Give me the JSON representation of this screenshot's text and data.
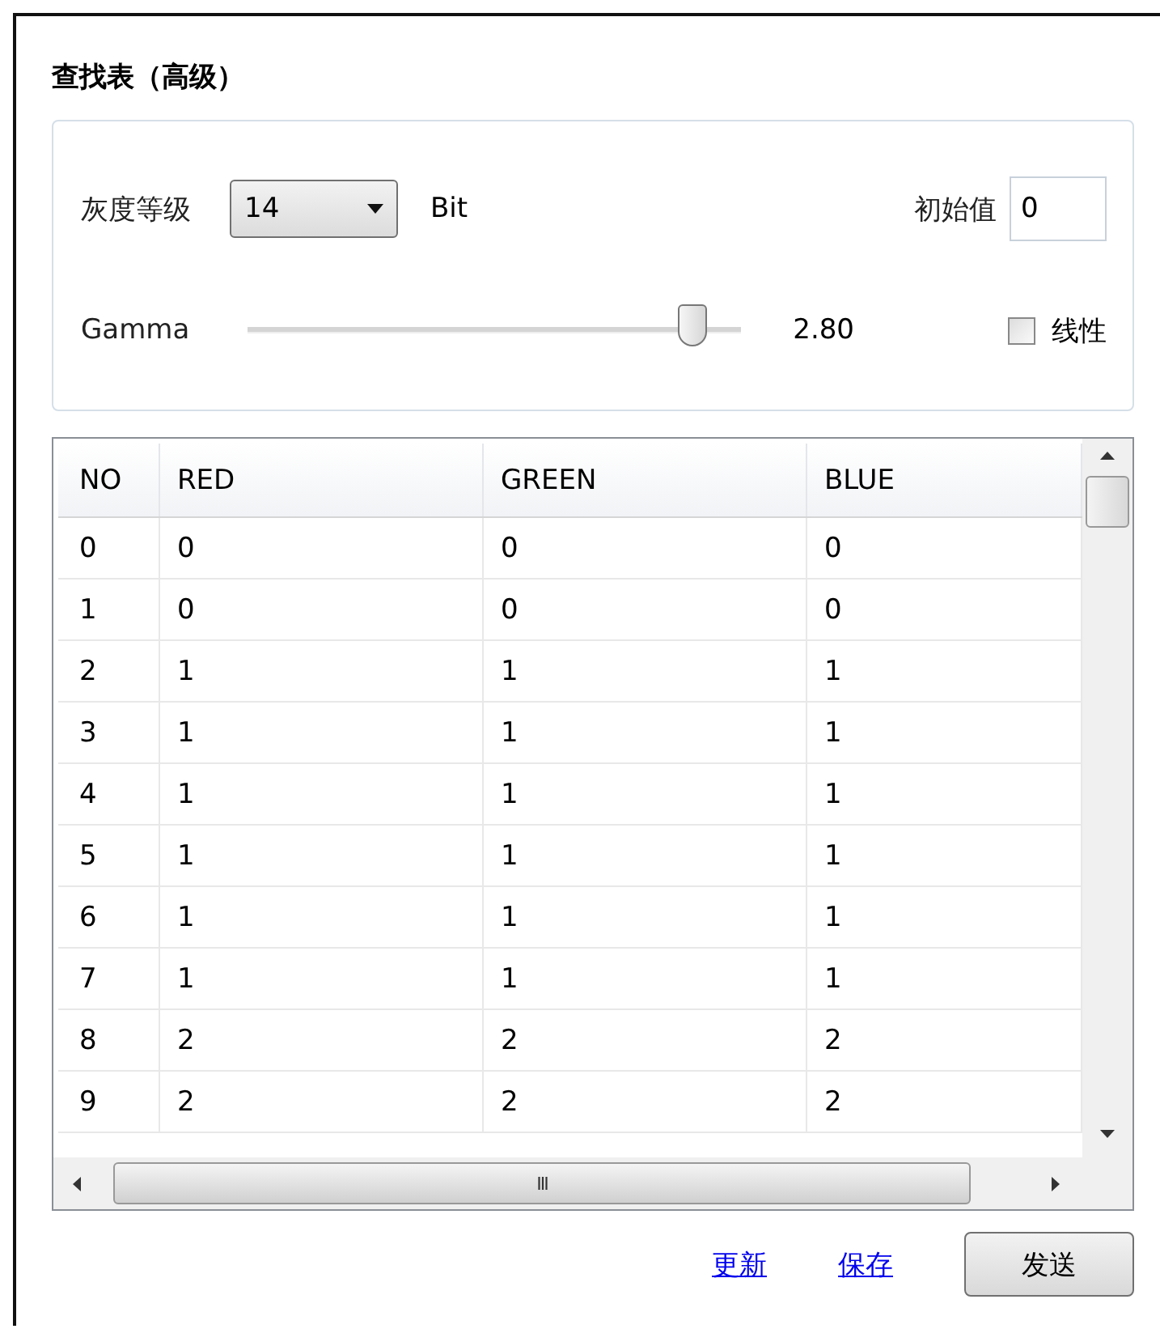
{
  "title": "查找表（高级）",
  "settings": {
    "gray_level_label": "灰度等级",
    "gray_level_value": "14",
    "gray_level_unit": "Bit",
    "initial_label": "初始值",
    "initial_value": "0",
    "gamma_label": "Gamma",
    "gamma": {
      "level": 0.9
    },
    "gamma_reading": "2.80",
    "linear": {
      "label": "线性",
      "checked": false
    }
  },
  "table": {
    "columns": [
      "NO",
      "RED",
      "GREEN",
      "BLUE"
    ],
    "rows": [
      [
        "0",
        "0",
        "0",
        "0"
      ],
      [
        "1",
        "0",
        "0",
        "0"
      ],
      [
        "2",
        "1",
        "1",
        "1"
      ],
      [
        "3",
        "1",
        "1",
        "1"
      ],
      [
        "4",
        "1",
        "1",
        "1"
      ],
      [
        "5",
        "1",
        "1",
        "1"
      ],
      [
        "6",
        "1",
        "1",
        "1"
      ],
      [
        "7",
        "1",
        "1",
        "1"
      ],
      [
        "8",
        "2",
        "2",
        "2"
      ],
      [
        "9",
        "2",
        "2",
        "2"
      ]
    ],
    "scroll_thumb_glyph": "III"
  },
  "actions": [
    {
      "kind": "link",
      "label": "更新"
    },
    {
      "kind": "link",
      "label": "保存"
    },
    {
      "kind": "button",
      "label": "发送"
    }
  ]
}
